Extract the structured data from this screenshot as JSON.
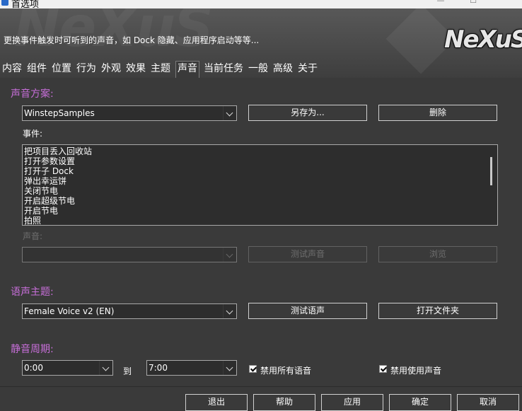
{
  "window": {
    "title": "首选项"
  },
  "header": {
    "description": "更换事件触发时可听到的声音，如 Dock 隐藏、应用程序启动等等...",
    "logo_text": "NeXuS",
    "tabs": [
      "内容",
      "组件",
      "位置",
      "行为",
      "外观",
      "效果",
      "主题",
      "声音",
      "当前任务",
      "一般",
      "高级",
      "关于"
    ],
    "active_tab": "声音"
  },
  "sound_scheme": {
    "title": "声音方案:",
    "selected": "WinstepSamples",
    "save_as_label": "另存为...",
    "delete_label": "删除"
  },
  "events": {
    "label": "事件:",
    "items": [
      "把项目丢入回收站",
      "打开参数设置",
      "打开子 Dock",
      "弹出幸运饼",
      "关闭节电",
      "开启超级节电",
      "开启节电",
      "拍照"
    ]
  },
  "sound": {
    "label": "声音:",
    "selected": "",
    "test_label": "测试声音",
    "browse_label": "浏览"
  },
  "voice_theme": {
    "title": "语声主题:",
    "selected": "Female Voice v2 (EN)",
    "test_label": "测试语声",
    "open_folder_label": "打开文件夹"
  },
  "mute_period": {
    "title": "静音周期:",
    "from": "0:00",
    "to_label": "到",
    "to": "7:00",
    "disable_voice_label": "禁用所有语音",
    "disable_voice_checked": true,
    "disable_sound_label": "禁用使用声音",
    "disable_sound_checked": true
  },
  "footer": {
    "exit_label": "退出",
    "help_label": "帮助",
    "apply_label": "应用",
    "ok_label": "确定",
    "cancel_label": "取消"
  },
  "colors": {
    "background": "#3a3a3a",
    "section_title": "#c76ed8",
    "input_bg": "#2d2d2d",
    "disabled_text": "#6e6e6e"
  }
}
